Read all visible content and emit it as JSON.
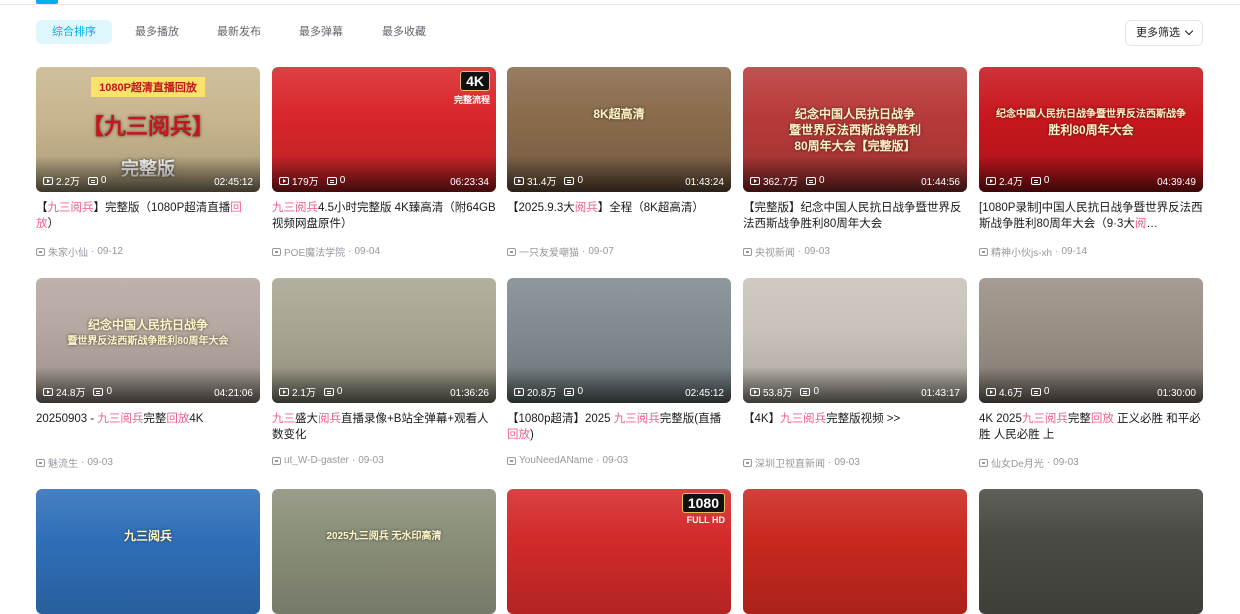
{
  "filters": {
    "tabs": [
      "综合排序",
      "最多播放",
      "最新发布",
      "最多弹幕",
      "最多收藏"
    ],
    "active_index": 0,
    "more_label": "更多筛选"
  },
  "cards": [
    {
      "thumb_bg": "#c9b68f",
      "banner": "1080P超清直播回放",
      "overlay": "【九三阅兵】",
      "overlay2": "完整版",
      "views": "2.2万",
      "danmaku": "0",
      "duration": "02:45:12",
      "title_parts": [
        {
          "t": "【"
        },
        {
          "t": "九三阅兵",
          "hl": true
        },
        {
          "t": "】完整版（1080P超清直播"
        },
        {
          "t": "回放",
          "hl": true
        },
        {
          "t": "）"
        }
      ],
      "author": "朱家小仙",
      "date": "09-12"
    },
    {
      "thumb_bg": "#d9262b",
      "badge": "4K",
      "badge_sub": "完整流程",
      "overlay": "",
      "views": "179万",
      "danmaku": "0",
      "duration": "06:23:34",
      "title_parts": [
        {
          "t": "九三阅兵",
          "hl": true
        },
        {
          "t": "4.5小时完整版 4K臻高清（附64GB视频网盘原件）"
        }
      ],
      "author": "POE魔法学院",
      "date": "09-04"
    },
    {
      "thumb_bg": "#8a6b4d",
      "overlay": "8K超高清",
      "views": "31.4万",
      "danmaku": "0",
      "duration": "01:43:24",
      "title_parts": [
        {
          "t": "【2025.9.3大"
        },
        {
          "t": "阅兵",
          "hl": true
        },
        {
          "t": "】全程（8K超高清）"
        }
      ],
      "author": "一只友爱嘲猫",
      "date": "09-07"
    },
    {
      "thumb_bg": "#b83a3a",
      "overlay": "纪念中国人民抗日战争",
      "overlay2": "暨世界反法西斯战争胜利",
      "overlay3": "80周年大会【完整版】",
      "views": "362.7万",
      "danmaku": "0",
      "duration": "01:44:56",
      "title_parts": [
        {
          "t": "【完整版】纪念中国人民抗日战争暨世界反法西斯战争胜利80周年大会"
        }
      ],
      "author": "央视新闻",
      "date": "09-03"
    },
    {
      "thumb_bg": "#c8171e",
      "overlay": "纪念中国人民抗日战争暨世界反法西斯战争",
      "overlay2": "胜利80周年大会",
      "views": "2.4万",
      "danmaku": "0",
      "duration": "04:39:49",
      "title_parts": [
        {
          "t": "[1080P录制]中国人民抗日战争暨世界反法西斯战争胜利80周年大会（9·3大"
        },
        {
          "t": "阅",
          "hl": true
        },
        {
          "t": "…"
        }
      ],
      "author": "精神小伙js-xh",
      "date": "09-14"
    },
    {
      "thumb_bg": "#b5a8a0",
      "overlay": "纪念中国人民抗日战争",
      "overlay2": "暨世界反法西斯战争胜利80周年大会",
      "views": "24.8万",
      "danmaku": "0",
      "duration": "04:21:06",
      "title_parts": [
        {
          "t": "20250903 - "
        },
        {
          "t": "九三阅兵",
          "hl": true
        },
        {
          "t": "完整"
        },
        {
          "t": "回放",
          "hl": true
        },
        {
          "t": "4K"
        }
      ],
      "author": "魅流生",
      "date": "09-03"
    },
    {
      "thumb_bg": "#a8a592",
      "overlay": "",
      "views": "2.1万",
      "danmaku": "0",
      "duration": "01:36:26",
      "title_parts": [
        {
          "t": "九三",
          "hl": true
        },
        {
          "t": "盛大"
        },
        {
          "t": "阅兵",
          "hl": true
        },
        {
          "t": "直播录像+B站全弹幕+观看人数变化"
        }
      ],
      "author": "ut_W-D-gaster",
      "date": "09-03"
    },
    {
      "thumb_bg": "#7f8b8f",
      "overlay": "",
      "views": "20.8万",
      "danmaku": "0",
      "duration": "02:45:12",
      "title_parts": [
        {
          "t": "【1080p超清】2025 "
        },
        {
          "t": "九三阅兵",
          "hl": true
        },
        {
          "t": "完整版(直播"
        },
        {
          "t": "回放",
          "hl": true
        },
        {
          "t": ")"
        }
      ],
      "author": "YouNeedAName",
      "date": "09-03"
    },
    {
      "thumb_bg": "#c9c2b8",
      "overlay": "",
      "views": "53.8万",
      "danmaku": "0",
      "duration": "01:43:17",
      "title_parts": [
        {
          "t": "【4K】"
        },
        {
          "t": "九三阅兵",
          "hl": true
        },
        {
          "t": "完整版视频 >>"
        }
      ],
      "author": "深圳卫视直新闻",
      "date": "09-03"
    },
    {
      "thumb_bg": "#9a8f85",
      "overlay": "",
      "views": "4.6万",
      "danmaku": "0",
      "duration": "01:30:00",
      "title_parts": [
        {
          "t": "4K 2025"
        },
        {
          "t": "九三阅兵",
          "hl": true
        },
        {
          "t": "完整"
        },
        {
          "t": "回放",
          "hl": true
        },
        {
          "t": " 正义必胜 和平必胜 人民必胜 上"
        }
      ],
      "author": "仙女De月光",
      "date": "09-03"
    },
    {
      "thumb_bg": "#2f6fb8",
      "overlay": "九三阅兵"
    },
    {
      "thumb_bg": "#8a8f7a",
      "overlay": "2025九三阅兵 无水印高清"
    },
    {
      "thumb_bg": "#d32a2a",
      "badge": "1080",
      "badge_sub": "FULL HD",
      "overlay": ""
    },
    {
      "thumb_bg": "#c9281f",
      "overlay": ""
    },
    {
      "thumb_bg": "#4a4a44",
      "overlay": ""
    }
  ]
}
